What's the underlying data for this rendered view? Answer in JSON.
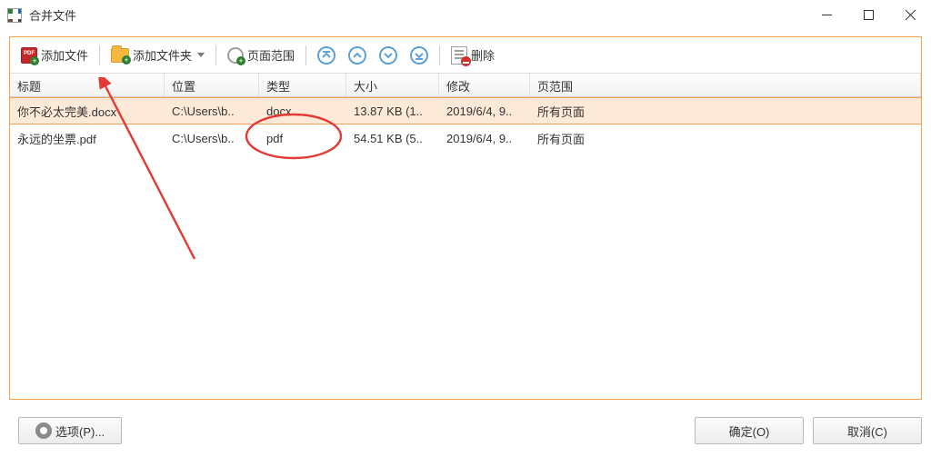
{
  "window": {
    "title": "合并文件"
  },
  "toolbar": {
    "add_file": "添加文件",
    "add_folder": "添加文件夹",
    "page_range": "页面范围",
    "delete": "删除"
  },
  "columns": {
    "title": "标题",
    "location": "位置",
    "type": "类型",
    "size": "大小",
    "modified": "修改",
    "page_range": "页范围"
  },
  "files": [
    {
      "title": "你不必太完美.docx",
      "location": "C:\\Users\\b..",
      "type": "docx",
      "size": "13.87 KB (1..",
      "modified": "2019/6/4, 9..",
      "page_range": "所有页面",
      "selected": true
    },
    {
      "title": "永远的坐票.pdf",
      "location": "C:\\Users\\b..",
      "type": "pdf",
      "size": "54.51 KB (5..",
      "modified": "2019/6/4, 9..",
      "page_range": "所有页面",
      "selected": false
    }
  ],
  "footer": {
    "options": "选项(P)...",
    "ok": "确定(O)",
    "cancel": "取消(C)"
  }
}
